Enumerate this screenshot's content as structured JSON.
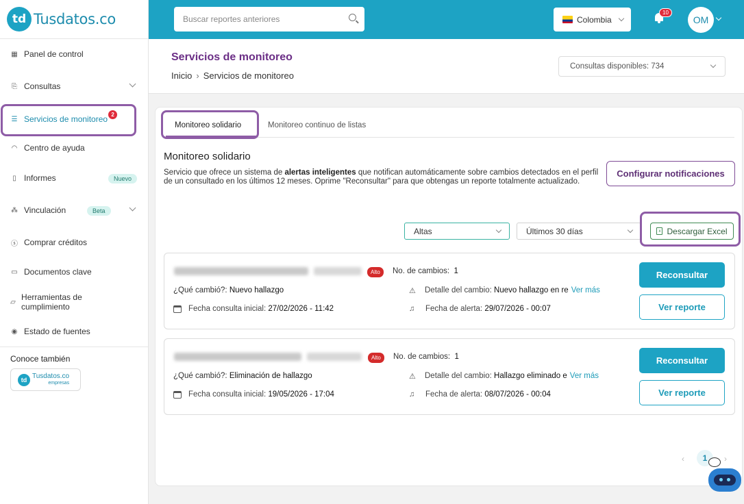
{
  "brand": {
    "name": "Tusdatos.co",
    "mark": "td"
  },
  "topbar": {
    "search_placeholder": "Buscar reportes anteriores",
    "country": "Colombia",
    "notifications_count": "10",
    "avatar_initials": "OM"
  },
  "sidebar": {
    "items": [
      {
        "label": "Panel de control",
        "icon": "dashboard-icon"
      },
      {
        "label": "Consultas",
        "icon": "document-search-icon"
      },
      {
        "label": "Servicios de monitoreo",
        "icon": "monitor-icon",
        "count": "2"
      },
      {
        "label": "Centro de ayuda",
        "icon": "headset-icon"
      },
      {
        "label": "Informes",
        "icon": "report-icon",
        "badge": "Nuevo"
      },
      {
        "label": "Vinculación",
        "icon": "network-icon",
        "badge": "Beta"
      },
      {
        "label": "Comprar créditos",
        "icon": "coin-icon"
      },
      {
        "label": "Documentos clave",
        "icon": "archive-icon"
      },
      {
        "label": "Herramientas de cumplimiento",
        "icon": "folder-icon"
      },
      {
        "label": "Estado de fuentes",
        "icon": "signal-icon"
      }
    ],
    "conoce_label": "Conoce también",
    "empresas_logo": {
      "name": "Tusdatos.co",
      "sub": "empresas"
    }
  },
  "page": {
    "title": "Servicios de monitoreo",
    "breadcrumb": [
      "Inicio",
      "Servicios de monitoreo"
    ],
    "credits": "Consultas disponibles: 734"
  },
  "tabs": [
    "Monitoreo solidario",
    "Monitoreo continuo de listas"
  ],
  "section": {
    "title": "Monitoreo solidario",
    "desc_pre": "Servicio que ofrece un sistema de ",
    "desc_bold": "alertas inteligentes",
    "desc_post": " que notifican automáticamente sobre cambios detectados en el perfil de un consultado en los últimos 12 meses.   Oprime \"Reconsultar\" para que obtengas un reporte totalmente actualizado.",
    "config_button": "Configurar notificaciones"
  },
  "filters": {
    "type": "Altas",
    "period": "Últimos 30 días",
    "excel_button": "Descargar Excel"
  },
  "results": [
    {
      "risk": "Alto",
      "changes_label": "No. de cambios:",
      "changes": "1",
      "what_label": "¿Qué cambió?:",
      "what": "Nuevo hallazgo",
      "detail_label": "Detalle del cambio:",
      "detail": "Nuevo hallazgo en re",
      "more": "Ver más",
      "initial_label": "Fecha consulta inicial:",
      "initial": "27/02/2026 - 11:42",
      "alert_label": "Fecha de alerta:",
      "alert": "29/07/2026 - 00:07",
      "reconsult": "Reconsultar",
      "report": "Ver reporte"
    },
    {
      "risk": "Alto",
      "changes_label": "No. de cambios:",
      "changes": "1",
      "what_label": "¿Qué cambió?:",
      "what": "Eliminación de hallazgo",
      "detail_label": "Detalle del cambio:",
      "detail": "Hallazgo eliminado e",
      "more": "Ver más",
      "initial_label": "Fecha consulta inicial:",
      "initial": "19/05/2026 - 17:04",
      "alert_label": "Fecha de alerta:",
      "alert": "08/07/2026 - 00:04",
      "reconsult": "Reconsultar",
      "report": "Ver reporte"
    }
  ],
  "pager": {
    "prev": "‹",
    "current": "1",
    "next": "›"
  },
  "colors": {
    "primary": "#1da3c4",
    "purple": "#6b2e86",
    "highlight": "#8e5ca6",
    "danger": "#d42b2b"
  }
}
